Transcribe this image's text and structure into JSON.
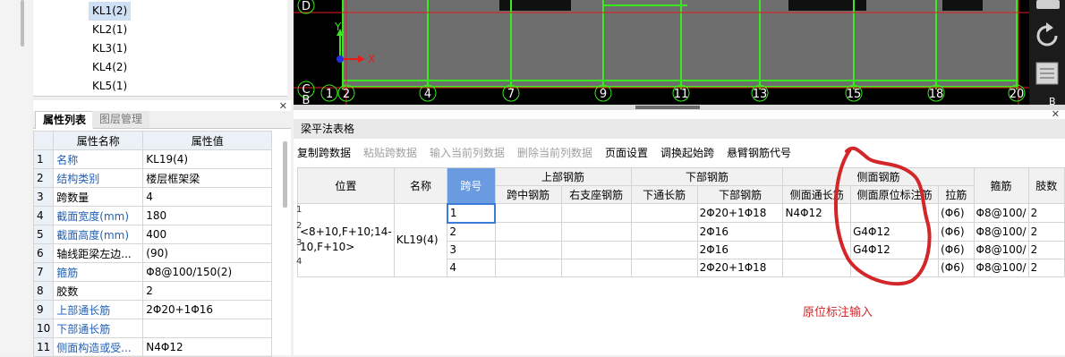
{
  "tree": {
    "items": [
      "KL1(2)",
      "KL2(1)",
      "KL3(1)",
      "KL4(2)",
      "KL5(1)"
    ],
    "selected_index": 0
  },
  "props_panel": {
    "tabs": [
      "属性列表",
      "图层管理"
    ],
    "header": {
      "name": "属性名称",
      "value": "属性值"
    },
    "rows": [
      {
        "idx": "1",
        "name": "名称",
        "value": "KL19(4)",
        "blue": true
      },
      {
        "idx": "2",
        "name": "结构类别",
        "value": "楼层框架梁",
        "blue": true
      },
      {
        "idx": "3",
        "name": "跨数量",
        "value": "4",
        "blue": false
      },
      {
        "idx": "4",
        "name": "截面宽度(mm)",
        "value": "180",
        "blue": true
      },
      {
        "idx": "5",
        "name": "截面高度(mm)",
        "value": "400",
        "blue": true
      },
      {
        "idx": "6",
        "name": "轴线距梁左边...",
        "value": "(90)",
        "blue": false
      },
      {
        "idx": "7",
        "name": "箍筋",
        "value": "Φ8@100/150(2)",
        "blue": true
      },
      {
        "idx": "8",
        "name": "胶数",
        "value": "2",
        "blue": false
      },
      {
        "idx": "9",
        "name": "上部通长筋",
        "value": "2Φ20+1Φ16",
        "blue": true
      },
      {
        "idx": "10",
        "name": "下部通长筋",
        "value": "",
        "blue": true
      },
      {
        "idx": "11",
        "name": "侧面构造或受...",
        "value": "N4Φ12",
        "blue": true
      }
    ]
  },
  "cad": {
    "axis_labels": [
      "1",
      "2",
      "4",
      "7",
      "9",
      "11",
      "13",
      "15",
      "18",
      "20"
    ],
    "row_labels": [
      "D",
      "C",
      "B"
    ],
    "ucs": {
      "x": "X",
      "y": "Y"
    },
    "right_label": "B"
  },
  "lp": {
    "title": "梁平法表格",
    "toolbar": [
      {
        "label": "复制跨数据",
        "enabled": true
      },
      {
        "label": "粘贴跨数据",
        "enabled": false
      },
      {
        "label": "输入当前列数据",
        "enabled": false
      },
      {
        "label": "删除当前列数据",
        "enabled": false
      },
      {
        "label": "页面设置",
        "enabled": true
      },
      {
        "label": "调换起始跨",
        "enabled": true
      },
      {
        "label": "悬臂钢筋代号",
        "enabled": true
      }
    ],
    "headers": {
      "pos": "位置",
      "name": "名称",
      "span": "跨号",
      "upper": "上部钢筋",
      "upper_mid": "跨中钢筋",
      "upper_right": "右支座钢筋",
      "lower": "下部钢筋",
      "lower_through": "下通长筋",
      "lower_bar": "下部钢筋",
      "side": "侧面钢筋",
      "side_through": "侧面通长筋",
      "side_inplace": "侧面原位标注筋",
      "tie": "拉筋",
      "stirrup": "箍筋",
      "legs": "肢数"
    },
    "position_text": "<8+10,F+10;14-10,F+10>",
    "beam_name": "KL19(4)",
    "row_markers": [
      "1",
      "2",
      "3",
      "4"
    ],
    "rows": [
      {
        "span": "1",
        "upper_mid": "",
        "upper_right": "",
        "lower_through": "",
        "lower_bar": "2Φ20+1Φ18",
        "side_through": "N4Φ12",
        "side_inplace": "",
        "tie": "(Φ6)",
        "stirrup": "Φ8@100/",
        "legs": "2"
      },
      {
        "span": "2",
        "upper_mid": "",
        "upper_right": "",
        "lower_through": "",
        "lower_bar": "2Φ16",
        "side_through": "",
        "side_inplace": "G4Φ12",
        "tie": "(Φ6)",
        "stirrup": "Φ8@100/",
        "legs": "2"
      },
      {
        "span": "3",
        "upper_mid": "",
        "upper_right": "",
        "lower_through": "",
        "lower_bar": "2Φ16",
        "side_through": "",
        "side_inplace": "G4Φ12",
        "tie": "(Φ6)",
        "stirrup": "Φ8@100/",
        "legs": "2"
      },
      {
        "span": "4",
        "upper_mid": "",
        "upper_right": "",
        "lower_through": "",
        "lower_bar": "2Φ20+1Φ18",
        "side_through": "",
        "side_inplace": "",
        "tie": "(Φ6)",
        "stirrup": "Φ8@100/",
        "legs": "2"
      }
    ]
  },
  "annotation": {
    "text": "原位标注输入",
    "color": "#d3262a"
  },
  "colors": {
    "cad_bg": "#000000",
    "slab": "#6e6e6e",
    "beam_green": "#39e81e",
    "axis_red": "#e51c1c",
    "selected_header": "#6a9be0"
  }
}
